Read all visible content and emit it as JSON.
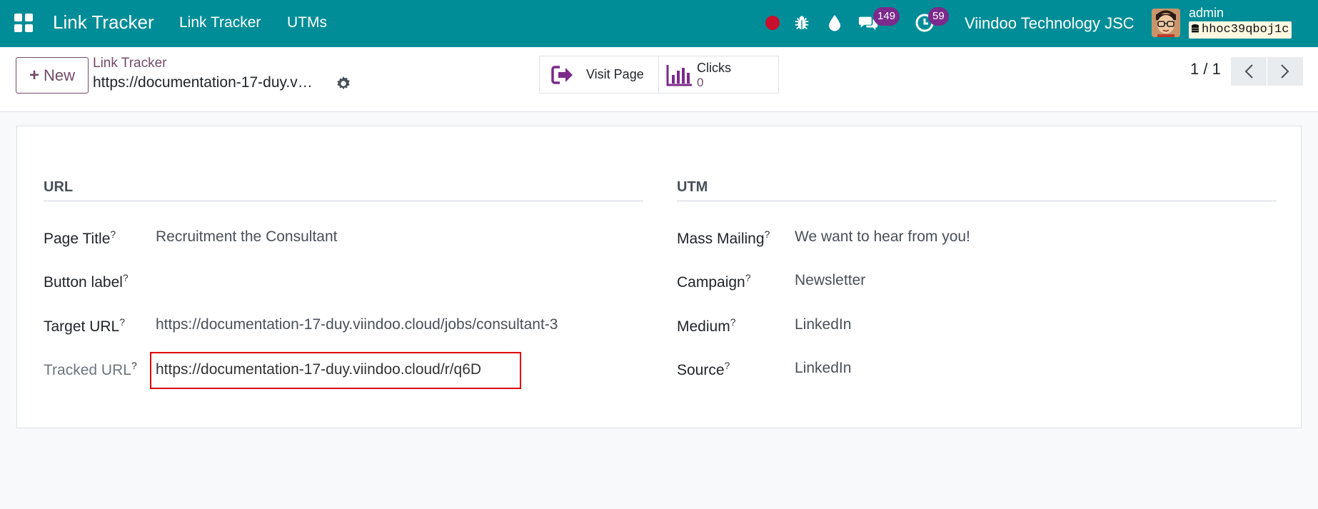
{
  "navbar": {
    "brand": "Link Tracker",
    "menu": [
      "Link Tracker",
      "UTMs"
    ],
    "messages_count": "149",
    "activities_count": "59",
    "company": "Viindoo Technology JSC",
    "user": "admin",
    "database": "hhoc39qboj1c",
    "colors": {
      "background": "#018d97",
      "badge": "#7c2a8c",
      "recording": "#c8102e"
    }
  },
  "control_panel": {
    "new_label": "New",
    "breadcrumb": "Link Tracker",
    "record_name": "https://documentation-17-duy.v…",
    "visit_page_label": "Visit Page",
    "clicks_label": "Clicks",
    "clicks_value": "0",
    "pager": "1 / 1"
  },
  "form": {
    "url_group": {
      "title": "URL",
      "page_title_label": "Page Title",
      "page_title_value": "Recruitment the Consultant",
      "button_label_label": "Button label",
      "button_label_value": "",
      "target_url_label": "Target URL",
      "target_url_value": "https://documentation-17-duy.viindoo.cloud/jobs/consultant-3",
      "tracked_url_label": "Tracked URL",
      "tracked_url_value": "https://documentation-17-duy.viindoo.cloud/r/q6D"
    },
    "utm_group": {
      "title": "UTM",
      "mass_mailing_label": "Mass Mailing",
      "mass_mailing_value": "We want to hear from you!",
      "campaign_label": "Campaign",
      "campaign_value": "Newsletter",
      "medium_label": "Medium",
      "medium_value": "LinkedIn",
      "source_label": "Source",
      "source_value": "LinkedIn"
    },
    "help_marker": "?",
    "accent_color": "#714b67",
    "highlight_color": "#e00000"
  }
}
